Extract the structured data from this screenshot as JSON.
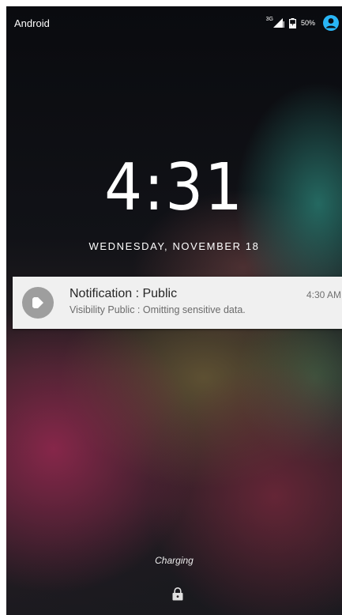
{
  "status_bar": {
    "carrier": "Android",
    "network_type": "3G",
    "signal_icon": "signal-bars-icon",
    "battery_icon": "battery-charging-icon",
    "battery_percent": "50%",
    "user_icon": "user-avatar-icon"
  },
  "lockscreen": {
    "time": "4:31",
    "date": "WEDNESDAY, NOVEMBER 18"
  },
  "notification": {
    "app_icon": "app-notification-icon",
    "title": "Notification : Public",
    "body": "Visibility Public : Omitting sensitive data.",
    "time": "4:30 AM"
  },
  "footer": {
    "status_text": "Charging",
    "lock_icon": "lock-icon"
  },
  "colors": {
    "accent": "#29b6f6",
    "notification_bg": "#f0f0f0",
    "notification_icon_bg": "#9e9e9e"
  }
}
